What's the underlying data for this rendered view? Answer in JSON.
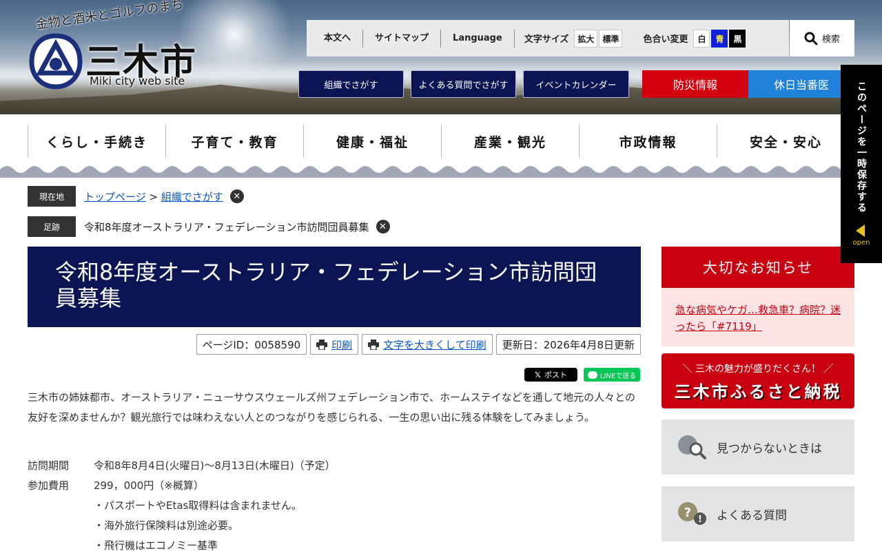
{
  "header": {
    "catchphrase": "金物と酒米とゴルフのまち",
    "city_name": "三木市",
    "site_subtitle": "Miki city web site"
  },
  "utility": {
    "links": [
      "本文へ",
      "サイトマップ",
      "Language"
    ],
    "font_size_label": "文字サイズ",
    "font_size_buttons": [
      "拡大",
      "標準"
    ],
    "color_label": "色合い変更",
    "color_buttons": [
      "白",
      "青",
      "黒"
    ],
    "search_label": "検索"
  },
  "quick_nav": {
    "items": [
      "組織でさがす",
      "よくある質問でさがす",
      "イベントカレンダー"
    ],
    "disaster": "防災情報",
    "holiday_doctor": "休日当番医"
  },
  "global_nav": [
    "くらし・手続き",
    "子育て・教育",
    "健康・福祉",
    "産業・観光",
    "市政情報",
    "安全・安心"
  ],
  "breadcrumb": {
    "current_label": "現在地",
    "top_link": "トップページ",
    "separator": ">",
    "section_link": "組織でさがす",
    "footprint_label": "足跡",
    "footprint_item": "令和8年度オーストラリア・フェデレーション市訪問団員募集"
  },
  "article": {
    "title": "令和8年度オーストラリア・フェデレーション市訪問団員募集",
    "page_id": "ページID：0058590",
    "print_label": "印刷",
    "large_print_label": "文字を大きくして印刷",
    "updated": "更新日：2026年4月8日更新",
    "share_x": "ポスト",
    "share_line": "LINEで送る",
    "intro": "三木市の姉妹都市、オーストラリア・ニューサウスウェールズ州フェデレーション市で、ホームステイなどを通して地元の人々との友好を深めませんか？観光旅行では味わえない人とのつながりを感じられる、一生の思い出に残る体験をしてみましょう。",
    "details": [
      {
        "term": "訪問期間",
        "desc": "令和8年8月4日(火曜日)～8月13日(木曜日)（予定）"
      },
      {
        "term": "参加費用",
        "desc": "299，000円（※概算）"
      },
      {
        "term": "",
        "desc": "・パスポートやEtas取得料は含まれません。"
      },
      {
        "term": "",
        "desc": "・海外旅行保険料は別途必要。"
      },
      {
        "term": "",
        "desc": "・飛行機はエコノミー基準"
      }
    ]
  },
  "sidebar": {
    "notice_title": "大切なお知らせ",
    "notice_link": "急な病気やケガ…救急車？病院？迷ったら「#7119」",
    "furusato_catch": "＼ 三木の魅力が盛りだくさん！ ／",
    "furusato_title": "三木市ふるさと納税",
    "not_found": "見つからないときは",
    "faq": "よくある質問"
  },
  "save_tab": {
    "label": "このページを一時保存する",
    "open": "open"
  },
  "colors": {
    "navy": "#0b1553",
    "red": "#c8000f",
    "blue": "#1f82d8",
    "link": "#0b57c4"
  }
}
